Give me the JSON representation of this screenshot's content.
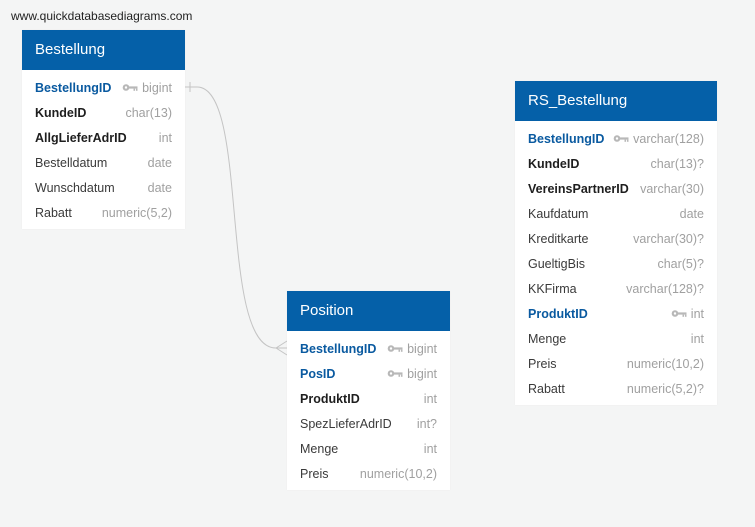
{
  "watermark": "www.quickdatabasediagrams.com",
  "colors": {
    "header": "#0560a8",
    "pk_text": "#0a5aa0",
    "type_text": "#a0a0a0",
    "connector": "#c4c4c4"
  },
  "tables": {
    "bestellung": {
      "title": "Bestellung",
      "columns": [
        {
          "name": "BestellungID",
          "type": "bigint",
          "role": "pk"
        },
        {
          "name": "KundeID",
          "type": "char(13)",
          "role": "fk"
        },
        {
          "name": "AllgLieferAdrID",
          "type": "int",
          "role": "fk"
        },
        {
          "name": "Bestelldatum",
          "type": "date",
          "role": ""
        },
        {
          "name": "Wunschdatum",
          "type": "date",
          "role": ""
        },
        {
          "name": "Rabatt",
          "type": "numeric(5,2)",
          "role": ""
        }
      ]
    },
    "position": {
      "title": "Position",
      "columns": [
        {
          "name": "BestellungID",
          "type": "bigint",
          "role": "pk"
        },
        {
          "name": "PosID",
          "type": "bigint",
          "role": "pk"
        },
        {
          "name": "ProduktID",
          "type": "int",
          "role": "fk"
        },
        {
          "name": "SpezLieferAdrID",
          "type": "int?",
          "role": ""
        },
        {
          "name": "Menge",
          "type": "int",
          "role": ""
        },
        {
          "name": "Preis",
          "type": "numeric(10,2)",
          "role": ""
        }
      ]
    },
    "rs_bestellung": {
      "title": "RS_Bestellung",
      "columns": [
        {
          "name": "BestellungID",
          "type": "varchar(128)",
          "role": "pk"
        },
        {
          "name": "KundeID",
          "type": "char(13)?",
          "role": "fk"
        },
        {
          "name": "VereinsPartnerID",
          "type": "varchar(30)",
          "role": "fk"
        },
        {
          "name": "Kaufdatum",
          "type": "date",
          "role": ""
        },
        {
          "name": "Kreditkarte",
          "type": "varchar(30)?",
          "role": ""
        },
        {
          "name": "GueltigBis",
          "type": "char(5)?",
          "role": ""
        },
        {
          "name": "KKFirma",
          "type": "varchar(128)?",
          "role": ""
        },
        {
          "name": "ProduktID",
          "type": "int",
          "role": "pk"
        },
        {
          "name": "Menge",
          "type": "int",
          "role": ""
        },
        {
          "name": "Preis",
          "type": "numeric(10,2)",
          "role": ""
        },
        {
          "name": "Rabatt",
          "type": "numeric(5,2)?",
          "role": ""
        }
      ]
    }
  }
}
